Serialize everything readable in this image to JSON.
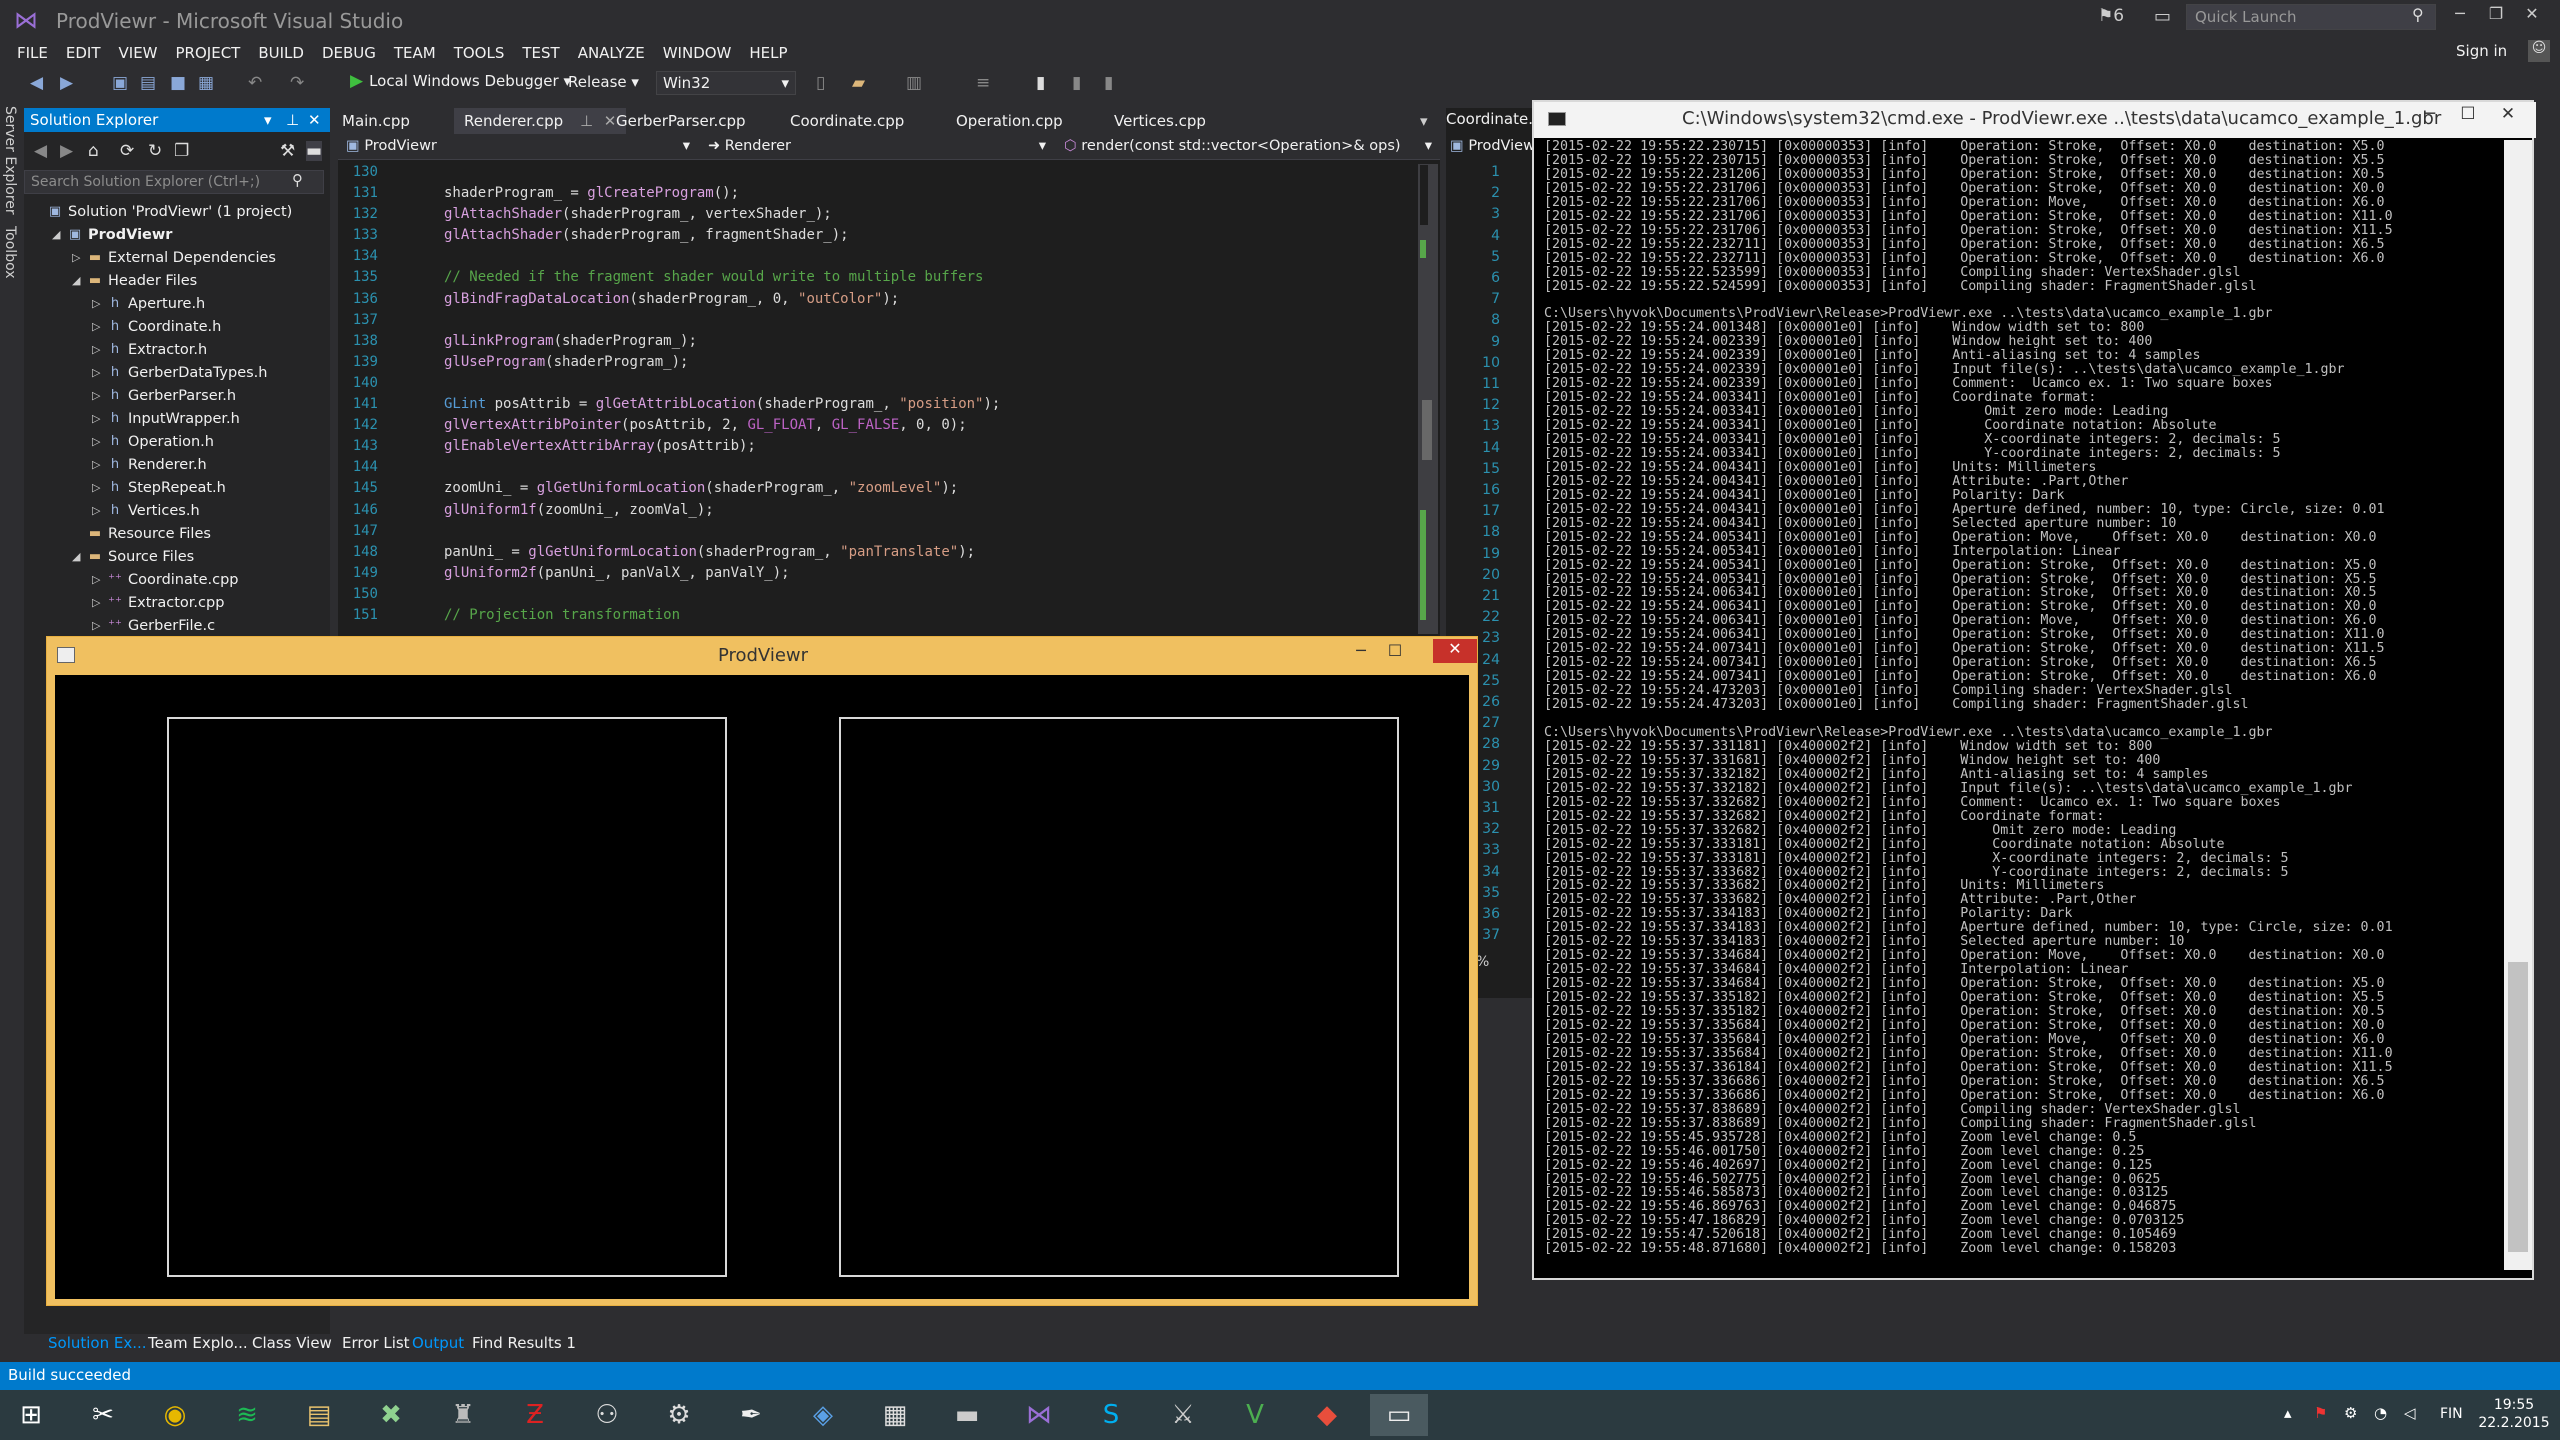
{
  "window": {
    "title": "ProdViewr - Microsoft Visual Studio"
  },
  "titlebar": {
    "notification_count": "6",
    "quick_launch_placeholder": "Quick Launch",
    "sign_in": "Sign in"
  },
  "menu": [
    "FILE",
    "EDIT",
    "VIEW",
    "PROJECT",
    "BUILD",
    "DEBUG",
    "TEAM",
    "TOOLS",
    "TEST",
    "ANALYZE",
    "WINDOW",
    "HELP"
  ],
  "toolbar": {
    "debugger": "Local Windows Debugger",
    "configuration": "Release",
    "platform": "Win32"
  },
  "side_tabs": [
    "Server Explorer",
    "Toolbox"
  ],
  "solution_explorer": {
    "title": "Solution Explorer",
    "search_placeholder": "Search Solution Explorer (Ctrl+;)",
    "items": [
      {
        "label": "Solution 'ProdViewr' (1 project)",
        "indent": 0,
        "icon": "solution-icon",
        "arrow": ""
      },
      {
        "label": "ProdViewr",
        "indent": 1,
        "icon": "project-icon",
        "arrow": "◢",
        "bold": true
      },
      {
        "label": "External Dependencies",
        "indent": 2,
        "icon": "folder-icon",
        "arrow": "▷"
      },
      {
        "label": "Header Files",
        "indent": 2,
        "icon": "folder-icon",
        "arrow": "◢"
      },
      {
        "label": "Aperture.h",
        "indent": 3,
        "icon": "header-file-icon",
        "arrow": "▷"
      },
      {
        "label": "Coordinate.h",
        "indent": 3,
        "icon": "header-file-icon",
        "arrow": "▷"
      },
      {
        "label": "Extractor.h",
        "indent": 3,
        "icon": "header-file-icon",
        "arrow": "▷"
      },
      {
        "label": "GerberDataTypes.h",
        "indent": 3,
        "icon": "header-file-icon",
        "arrow": "▷"
      },
      {
        "label": "GerberParser.h",
        "indent": 3,
        "icon": "header-file-icon",
        "arrow": "▷"
      },
      {
        "label": "InputWrapper.h",
        "indent": 3,
        "icon": "header-file-icon",
        "arrow": "▷"
      },
      {
        "label": "Operation.h",
        "indent": 3,
        "icon": "header-file-icon",
        "arrow": "▷"
      },
      {
        "label": "Renderer.h",
        "indent": 3,
        "icon": "header-file-icon",
        "arrow": "▷"
      },
      {
        "label": "StepRepeat.h",
        "indent": 3,
        "icon": "header-file-icon",
        "arrow": "▷"
      },
      {
        "label": "Vertices.h",
        "indent": 3,
        "icon": "header-file-icon",
        "arrow": "▷"
      },
      {
        "label": "Resource Files",
        "indent": 2,
        "icon": "folder-icon",
        "arrow": ""
      },
      {
        "label": "Source Files",
        "indent": 2,
        "icon": "folder-icon",
        "arrow": "◢"
      },
      {
        "label": "Coordinate.cpp",
        "indent": 3,
        "icon": "cpp-file-icon",
        "arrow": "▷"
      },
      {
        "label": "Extractor.cpp",
        "indent": 3,
        "icon": "cpp-file-icon",
        "arrow": "▷"
      },
      {
        "label": "GerberFile.c",
        "indent": 3,
        "icon": "cpp-file-icon",
        "arrow": "▷"
      }
    ]
  },
  "editor": {
    "tabs": [
      "Main.cpp",
      "Renderer.cpp",
      "GerberParser.cpp",
      "Coordinate.cpp",
      "Operation.cpp",
      "Vertices.cpp"
    ],
    "active_tab": "Renderer.cpp",
    "nav_project": "ProdViewr",
    "nav_class": "Renderer",
    "nav_member": "render(const std::vector<Operation>& ops)",
    "lines": [
      {
        "n": "130",
        "t": ""
      },
      {
        "n": "131",
        "t": "shaderProgram_ = glCreateProgram();"
      },
      {
        "n": "132",
        "t": "glAttachShader(shaderProgram_, vertexShader_);"
      },
      {
        "n": "133",
        "t": "glAttachShader(shaderProgram_, fragmentShader_);"
      },
      {
        "n": "134",
        "t": ""
      },
      {
        "n": "135",
        "t": "// Needed if the fragment shader would write to multiple buffers"
      },
      {
        "n": "136",
        "t": "glBindFragDataLocation(shaderProgram_, 0, \"outColor\");"
      },
      {
        "n": "137",
        "t": ""
      },
      {
        "n": "138",
        "t": "glLinkProgram(shaderProgram_);"
      },
      {
        "n": "139",
        "t": "glUseProgram(shaderProgram_);"
      },
      {
        "n": "140",
        "t": ""
      },
      {
        "n": "141",
        "t": "GLint posAttrib = glGetAttribLocation(shaderProgram_, \"position\");"
      },
      {
        "n": "142",
        "t": "glVertexAttribPointer(posAttrib, 2, GL_FLOAT, GL_FALSE, 0, 0);"
      },
      {
        "n": "143",
        "t": "glEnableVertexAttribArray(posAttrib);"
      },
      {
        "n": "144",
        "t": ""
      },
      {
        "n": "145",
        "t": "zoomUni_ = glGetUniformLocation(shaderProgram_, \"zoomLevel\");"
      },
      {
        "n": "146",
        "t": "glUniform1f(zoomUni_, zoomVal_);"
      },
      {
        "n": "147",
        "t": ""
      },
      {
        "n": "148",
        "t": "panUni_ = glGetUniformLocation(shaderProgram_, \"panTranslate\");"
      },
      {
        "n": "149",
        "t": "glUniform2f(panUni_, panValX_, panValY_);"
      },
      {
        "n": "150",
        "t": ""
      },
      {
        "n": "151",
        "t": "// Projection transformation"
      }
    ]
  },
  "editor2": {
    "tab": "Coordinate.h",
    "nav": "ProdViewr",
    "line_numbers": [
      "1",
      "2",
      "3",
      "4",
      "5",
      "6",
      "7",
      "8",
      "9",
      "10",
      "11",
      "12",
      "13",
      "14",
      "15",
      "16",
      "17",
      "18",
      "19",
      "20",
      "21",
      "22",
      "23",
      "24",
      "25",
      "26",
      "27",
      "28",
      "29",
      "30",
      "31",
      "32",
      "33",
      "34",
      "35",
      "36",
      "37"
    ],
    "zoom": "%"
  },
  "prod_window": {
    "title": "ProdViewr"
  },
  "console": {
    "title": "C:\\Windows\\system32\\cmd.exe - ProdViewr.exe ..\\tests\\data\\ucamco_example_1.gbr",
    "lines": [
      "[2015-02-22 19:55:22.230715] [0x00000353] [info]    Operation: Stroke,  Offset: X0.0    destination: X5.0",
      "[2015-02-22 19:55:22.230715] [0x00000353] [info]    Operation: Stroke,  Offset: X0.0    destination: X5.5",
      "[2015-02-22 19:55:22.231206] [0x00000353] [info]    Operation: Stroke,  Offset: X0.0    destination: X0.5",
      "[2015-02-22 19:55:22.231706] [0x00000353] [info]    Operation: Stroke,  Offset: X0.0    destination: X0.0",
      "[2015-02-22 19:55:22.231706] [0x00000353] [info]    Operation: Move,    Offset: X0.0    destination: X6.0",
      "[2015-02-22 19:55:22.231706] [0x00000353] [info]    Operation: Stroke,  Offset: X0.0    destination: X11.0",
      "[2015-02-22 19:55:22.231706] [0x00000353] [info]    Operation: Stroke,  Offset: X0.0    destination: X11.5",
      "[2015-02-22 19:55:22.232711] [0x00000353] [info]    Operation: Stroke,  Offset: X0.0    destination: X6.5",
      "[2015-02-22 19:55:22.232711] [0x00000353] [info]    Operation: Stroke,  Offset: X0.0    destination: X6.0",
      "[2015-02-22 19:55:22.523599] [0x00000353] [info]    Compiling shader: VertexShader.glsl",
      "[2015-02-22 19:55:22.524599] [0x00000353] [info]    Compiling shader: FragmentShader.glsl",
      "",
      "C:\\Users\\hyvok\\Documents\\ProdViewr\\Release>ProdViewr.exe ..\\tests\\data\\ucamco_example_1.gbr",
      "[2015-02-22 19:55:24.001348] [0x00001e0] [info]    Window width set to: 800",
      "[2015-02-22 19:55:24.002339] [0x00001e0] [info]    Window height set to: 400",
      "[2015-02-22 19:55:24.002339] [0x00001e0] [info]    Anti-aliasing set to: 4 samples",
      "[2015-02-22 19:55:24.002339] [0x00001e0] [info]    Input file(s): ..\\tests\\data\\ucamco_example_1.gbr",
      "[2015-02-22 19:55:24.002339] [0x00001e0] [info]    Comment:  Ucamco ex. 1: Two square boxes",
      "[2015-02-22 19:55:24.003341] [0x00001e0] [info]    Coordinate format:",
      "[2015-02-22 19:55:24.003341] [0x00001e0] [info]        Omit zero mode: Leading",
      "[2015-02-22 19:55:24.003341] [0x00001e0] [info]        Coordinate notation: Absolute",
      "[2015-02-22 19:55:24.003341] [0x00001e0] [info]        X-coordinate integers: 2, decimals: 5",
      "[2015-02-22 19:55:24.003341] [0x00001e0] [info]        Y-coordinate integers: 2, decimals: 5",
      "[2015-02-22 19:55:24.004341] [0x00001e0] [info]    Units: Millimeters",
      "[2015-02-22 19:55:24.004341] [0x00001e0] [info]    Attribute: .Part,Other",
      "[2015-02-22 19:55:24.004341] [0x00001e0] [info]    Polarity: Dark",
      "[2015-02-22 19:55:24.004341] [0x00001e0] [info]    Aperture defined, number: 10, type: Circle, size: 0.01",
      "[2015-02-22 19:55:24.004341] [0x00001e0] [info]    Selected aperture number: 10",
      "[2015-02-22 19:55:24.005341] [0x00001e0] [info]    Operation: Move,    Offset: X0.0    destination: X0.0",
      "[2015-02-22 19:55:24.005341] [0x00001e0] [info]    Interpolation: Linear",
      "[2015-02-22 19:55:24.005341] [0x00001e0] [info]    Operation: Stroke,  Offset: X0.0    destination: X5.0",
      "[2015-02-22 19:55:24.005341] [0x00001e0] [info]    Operation: Stroke,  Offset: X0.0    destination: X5.5",
      "[2015-02-22 19:55:24.006341] [0x00001e0] [info]    Operation: Stroke,  Offset: X0.0    destination: X0.5",
      "[2015-02-22 19:55:24.006341] [0x00001e0] [info]    Operation: Stroke,  Offset: X0.0    destination: X0.0",
      "[2015-02-22 19:55:24.006341] [0x00001e0] [info]    Operation: Move,    Offset: X0.0    destination: X6.0",
      "[2015-02-22 19:55:24.006341] [0x00001e0] [info]    Operation: Stroke,  Offset: X0.0    destination: X11.0",
      "[2015-02-22 19:55:24.007341] [0x00001e0] [info]    Operation: Stroke,  Offset: X0.0    destination: X11.5",
      "[2015-02-22 19:55:24.007341] [0x00001e0] [info]    Operation: Stroke,  Offset: X0.0    destination: X6.5",
      "[2015-02-22 19:55:24.007341] [0x00001e0] [info]    Operation: Stroke,  Offset: X0.0    destination: X6.0",
      "[2015-02-22 19:55:24.473203] [0x00001e0] [info]    Compiling shader: VertexShader.glsl",
      "[2015-02-22 19:55:24.473203] [0x00001e0] [info]    Compiling shader: FragmentShader.glsl",
      "",
      "C:\\Users\\hyvok\\Documents\\ProdViewr\\Release>ProdViewr.exe ..\\tests\\data\\ucamco_example_1.gbr",
      "[2015-02-22 19:55:37.331181] [0x400002f2] [info]    Window width set to: 800",
      "[2015-02-22 19:55:37.331681] [0x400002f2] [info]    Window height set to: 400",
      "[2015-02-22 19:55:37.332182] [0x400002f2] [info]    Anti-aliasing set to: 4 samples",
      "[2015-02-22 19:55:37.332182] [0x400002f2] [info]    Input file(s): ..\\tests\\data\\ucamco_example_1.gbr",
      "[2015-02-22 19:55:37.332682] [0x400002f2] [info]    Comment:  Ucamco ex. 1: Two square boxes",
      "[2015-02-22 19:55:37.332682] [0x400002f2] [info]    Coordinate format:",
      "[2015-02-22 19:55:37.332682] [0x400002f2] [info]        Omit zero mode: Leading",
      "[2015-02-22 19:55:37.333181] [0x400002f2] [info]        Coordinate notation: Absolute",
      "[2015-02-22 19:55:37.333181] [0x400002f2] [info]        X-coordinate integers: 2, decimals: 5",
      "[2015-02-22 19:55:37.333682] [0x400002f2] [info]        Y-coordinate integers: 2, decimals: 5",
      "[2015-02-22 19:55:37.333682] [0x400002f2] [info]    Units: Millimeters",
      "[2015-02-22 19:55:37.333682] [0x400002f2] [info]    Attribute: .Part,Other",
      "[2015-02-22 19:55:37.334183] [0x400002f2] [info]    Polarity: Dark",
      "[2015-02-22 19:55:37.334183] [0x400002f2] [info]    Aperture defined, number: 10, type: Circle, size: 0.01",
      "[2015-02-22 19:55:37.334183] [0x400002f2] [info]    Selected aperture number: 10",
      "[2015-02-22 19:55:37.334684] [0x400002f2] [info]    Operation: Move,    Offset: X0.0    destination: X0.0",
      "[2015-02-22 19:55:37.334684] [0x400002f2] [info]    Interpolation: Linear",
      "[2015-02-22 19:55:37.334684] [0x400002f2] [info]    Operation: Stroke,  Offset: X0.0    destination: X5.0",
      "[2015-02-22 19:55:37.335182] [0x400002f2] [info]    Operation: Stroke,  Offset: X0.0    destination: X5.5",
      "[2015-02-22 19:55:37.335182] [0x400002f2] [info]    Operation: Stroke,  Offset: X0.0    destination: X0.5",
      "[2015-02-22 19:55:37.335684] [0x400002f2] [info]    Operation: Stroke,  Offset: X0.0    destination: X0.0",
      "[2015-02-22 19:55:37.335684] [0x400002f2] [info]    Operation: Move,    Offset: X0.0    destination: X6.0",
      "[2015-02-22 19:55:37.335684] [0x400002f2] [info]    Operation: Stroke,  Offset: X0.0    destination: X11.0",
      "[2015-02-22 19:55:37.336184] [0x400002f2] [info]    Operation: Stroke,  Offset: X0.0    destination: X11.5",
      "[2015-02-22 19:55:37.336686] [0x400002f2] [info]    Operation: Stroke,  Offset: X0.0    destination: X6.5",
      "[2015-02-22 19:55:37.336686] [0x400002f2] [info]    Operation: Stroke,  Offset: X0.0    destination: X6.0",
      "[2015-02-22 19:55:37.838689] [0x400002f2] [info]    Compiling shader: VertexShader.glsl",
      "[2015-02-22 19:55:37.838689] [0x400002f2] [info]    Compiling shader: FragmentShader.glsl",
      "[2015-02-22 19:55:45.935728] [0x400002f2] [info]    Zoom level change: 0.5",
      "[2015-02-22 19:55:46.001750] [0x400002f2] [info]    Zoom level change: 0.25",
      "[2015-02-22 19:55:46.402697] [0x400002f2] [info]    Zoom level change: 0.125",
      "[2015-02-22 19:55:46.502775] [0x400002f2] [info]    Zoom level change: 0.0625",
      "[2015-02-22 19:55:46.585873] [0x400002f2] [info]    Zoom level change: 0.03125",
      "[2015-02-22 19:55:46.869763] [0x400002f2] [info]    Zoom level change: 0.046875",
      "[2015-02-22 19:55:47.186829] [0x400002f2] [info]    Zoom level change: 0.0703125",
      "[2015-02-22 19:55:47.520618] [0x400002f2] [info]    Zoom level change: 0.105469",
      "[2015-02-22 19:55:48.871680] [0x400002f2] [info]    Zoom level change: 0.158203"
    ]
  },
  "bottom_tabs": [
    "Solution Ex...",
    "Team Explo...",
    "Class View",
    "Error List",
    "Output",
    "Find Results 1"
  ],
  "active_bottom_tab": "Output",
  "status": "Build succeeded",
  "taskbar": {
    "apps": [
      "windows-start-icon",
      "snipping-tool-icon",
      "chrome-icon",
      "spotify-icon",
      "file-explorer-icon",
      "pcb-tool-icon",
      "tank-game-icon",
      "filezilla-icon",
      "putty-icon",
      "steam-icon",
      "inkscape-icon",
      "virtualbox-icon",
      "calculator-icon",
      "cmd-icon",
      "visual-studio-icon",
      "skype-icon",
      "eagle-icon",
      "vim-icon",
      "git-icon",
      "prodviewr-icon"
    ],
    "language": "FIN",
    "time": "19:55",
    "date": "22.2.2015"
  },
  "colors": {
    "vs_blue": "#007acc",
    "prodviewr_frame": "#f0c060",
    "close_red": "#c7312a"
  }
}
